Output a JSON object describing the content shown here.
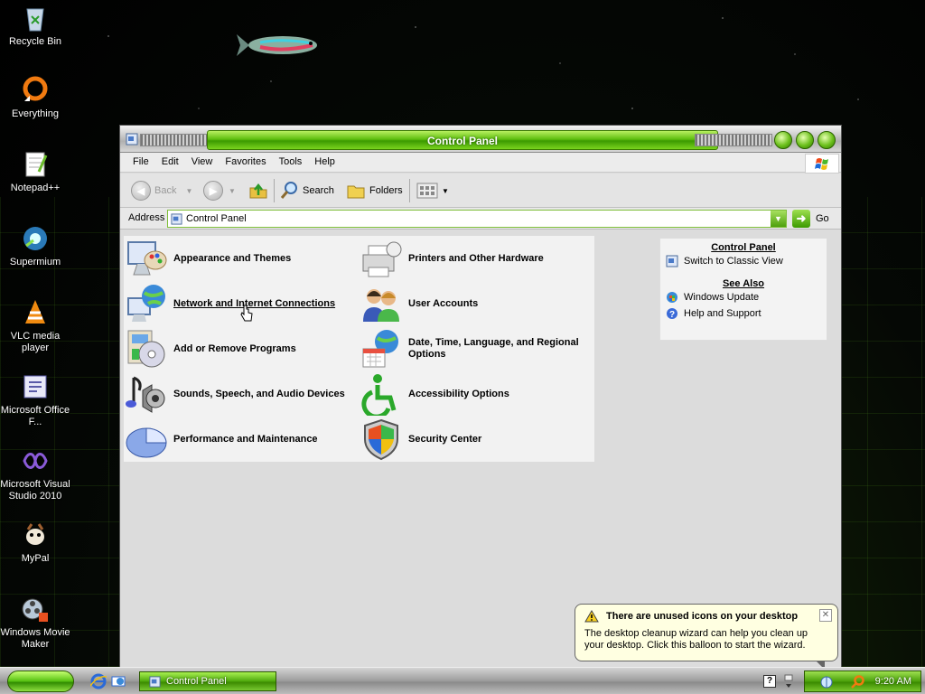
{
  "desktop": {
    "icons": [
      {
        "label": "Recycle Bin",
        "icon": "recycle-bin-icon"
      },
      {
        "label": "Everything",
        "icon": "everything-icon"
      },
      {
        "label": "Notepad++",
        "icon": "notepad-icon"
      },
      {
        "label": "Supermium",
        "icon": "supermium-icon"
      },
      {
        "label": "VLC media player",
        "icon": "vlc-icon"
      },
      {
        "label": "Microsoft Office F...",
        "icon": "office-icon"
      },
      {
        "label": "Microsoft Visual Studio 2010",
        "icon": "visual-studio-icon"
      },
      {
        "label": "MyPal",
        "icon": "mypal-icon"
      },
      {
        "label": "Windows Movie Maker",
        "icon": "movie-maker-icon"
      }
    ]
  },
  "window": {
    "title": "Control Panel",
    "menu": [
      "File",
      "Edit",
      "View",
      "Favorites",
      "Tools",
      "Help"
    ],
    "toolbar": {
      "back": "Back",
      "search": "Search",
      "folders": "Folders"
    },
    "address": {
      "label": "Address",
      "value": "Control Panel",
      "go": "Go"
    },
    "categories": [
      {
        "label": "Appearance and Themes",
        "icon": "appearance-icon"
      },
      {
        "label": "Printers and Other Hardware",
        "icon": "printer-icon"
      },
      {
        "label": "Network and Internet Connections",
        "icon": "network-icon"
      },
      {
        "label": "User Accounts",
        "icon": "user-accounts-icon"
      },
      {
        "label": "Add or Remove Programs",
        "icon": "add-remove-icon"
      },
      {
        "label": "Date, Time, Language, and Regional Options",
        "icon": "date-time-icon"
      },
      {
        "label": "Sounds, Speech, and Audio Devices",
        "icon": "sounds-icon"
      },
      {
        "label": "Accessibility Options",
        "icon": "accessibility-icon"
      },
      {
        "label": "Performance and Maintenance",
        "icon": "performance-icon"
      },
      {
        "label": "Security Center",
        "icon": "security-shield-icon"
      }
    ],
    "sidepanel": {
      "heading1": "Control Panel",
      "switch": "Switch to Classic View",
      "heading2": "See Also",
      "links": [
        "Windows Update",
        "Help and Support"
      ]
    }
  },
  "balloon": {
    "title": "There are unused icons on your desktop",
    "body": "The desktop cleanup wizard can help you clean up your desktop. Click this balloon to start the wizard."
  },
  "taskbar": {
    "task": "Control Panel",
    "clock": "9:20 AM",
    "help": "?"
  },
  "colors": {
    "accent_green": "#5fbf10",
    "balloon_bg": "#ffffe1"
  }
}
